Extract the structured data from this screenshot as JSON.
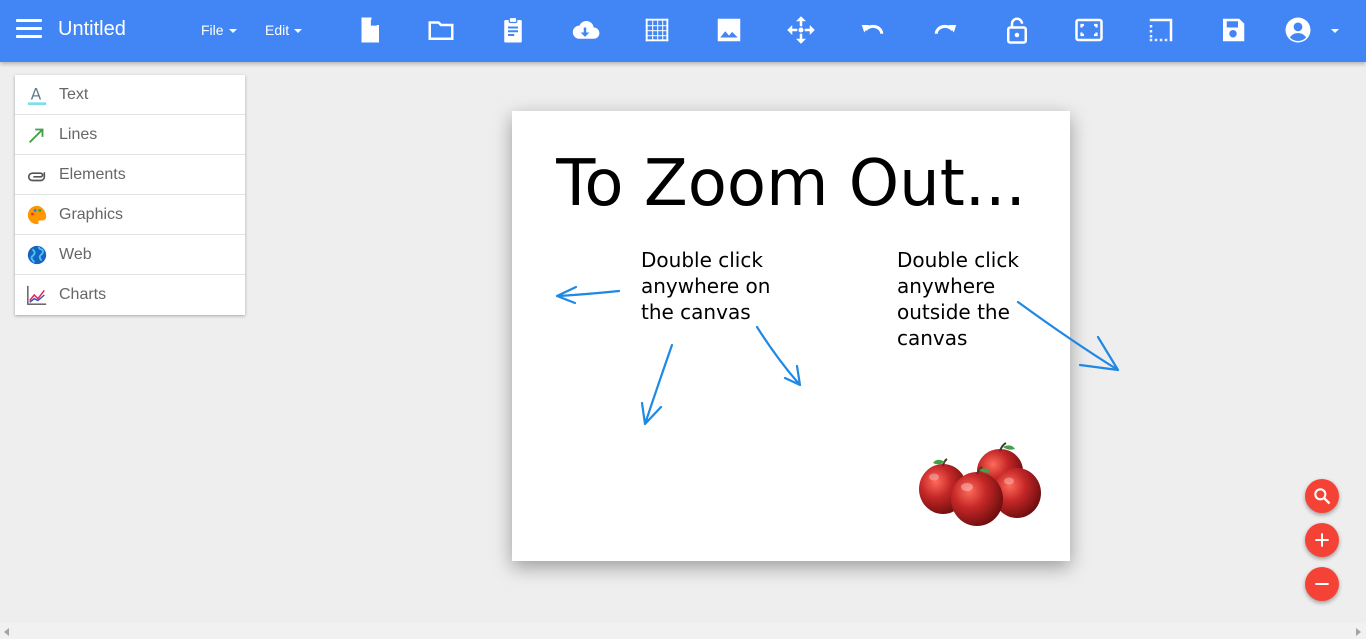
{
  "app": {
    "title": "Untitled",
    "menus": [
      "File",
      "Edit"
    ],
    "accent_color": "#4285f4"
  },
  "toolbar": {
    "icons": [
      "new-document-icon",
      "open-folder-icon",
      "clipboard-icon",
      "cloud-download-icon",
      "grid-icon",
      "image-icon",
      "move-icon",
      "undo-icon",
      "redo-icon",
      "lock-icon",
      "fit-screen-icon",
      "border-icon",
      "save-icon",
      "account-icon"
    ]
  },
  "panel": {
    "items": [
      {
        "label": "Text",
        "icon": "text-icon"
      },
      {
        "label": "Lines",
        "icon": "arrow-line-icon"
      },
      {
        "label": "Elements",
        "icon": "paperclip-icon"
      },
      {
        "label": "Graphics",
        "icon": "palette-icon"
      },
      {
        "label": "Web",
        "icon": "globe-icon"
      },
      {
        "label": "Charts",
        "icon": "line-chart-icon"
      }
    ]
  },
  "canvas": {
    "title": "To Zoom Out...",
    "note_left": "Double click\nanywhere on\nthe canvas",
    "note_right": "Double click\nanywhere\noutside the\ncanvas",
    "arrow_color": "#1e88e5",
    "image": "apples"
  },
  "zoom_controls": {
    "buttons": [
      "zoom-search-icon",
      "zoom-in-icon",
      "zoom-out-icon"
    ],
    "color": "#f44336"
  }
}
